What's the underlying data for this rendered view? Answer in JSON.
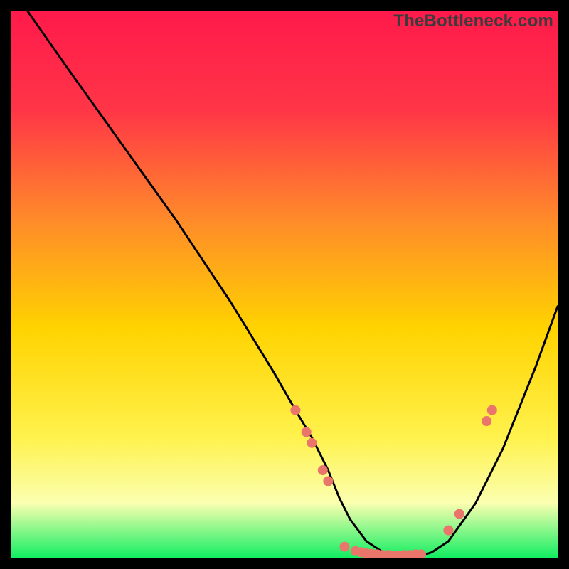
{
  "watermark": "TheBottleneck.com",
  "chart_data": {
    "type": "line",
    "title": "",
    "xlabel": "",
    "ylabel": "",
    "xlim": [
      0,
      100
    ],
    "ylim": [
      0,
      100
    ],
    "background_gradient": {
      "top": "#ff1a4b",
      "upper_mid": "#ff7a33",
      "mid": "#ffd300",
      "lower_mid": "#fff24d",
      "bottom": "#12ee62"
    },
    "curve": {
      "description": "V-shaped bottleneck curve; falls from upper-left, flat valley near bottom around x≈60-75, rises toward right edge",
      "x": [
        3,
        10,
        20,
        30,
        40,
        48,
        52,
        55,
        58,
        60,
        62,
        65,
        68,
        71,
        74,
        77,
        80,
        85,
        90,
        96,
        100
      ],
      "y": [
        100,
        90,
        76,
        62,
        47,
        34,
        27,
        22,
        16,
        11,
        7,
        3,
        1,
        0,
        0,
        1,
        3,
        10,
        20,
        35,
        46
      ]
    },
    "markers": {
      "description": "Salmon dots clustered along the valley and lower flanks of the curve",
      "color": "#e9756b",
      "points": [
        {
          "x": 52,
          "y": 27
        },
        {
          "x": 54,
          "y": 23
        },
        {
          "x": 55,
          "y": 21
        },
        {
          "x": 57,
          "y": 16
        },
        {
          "x": 58,
          "y": 14
        },
        {
          "x": 61,
          "y": 2
        },
        {
          "x": 63,
          "y": 1.2
        },
        {
          "x": 64,
          "y": 1
        },
        {
          "x": 65,
          "y": 0.8
        },
        {
          "x": 66,
          "y": 0.7
        },
        {
          "x": 67,
          "y": 0.6
        },
        {
          "x": 68,
          "y": 0.5
        },
        {
          "x": 69,
          "y": 0.5
        },
        {
          "x": 70,
          "y": 0.4
        },
        {
          "x": 71,
          "y": 0.4
        },
        {
          "x": 72,
          "y": 0.5
        },
        {
          "x": 73,
          "y": 0.5
        },
        {
          "x": 74,
          "y": 0.6
        },
        {
          "x": 75,
          "y": 0.6
        },
        {
          "x": 80,
          "y": 5
        },
        {
          "x": 82,
          "y": 8
        },
        {
          "x": 87,
          "y": 25
        },
        {
          "x": 88,
          "y": 27
        }
      ]
    }
  }
}
